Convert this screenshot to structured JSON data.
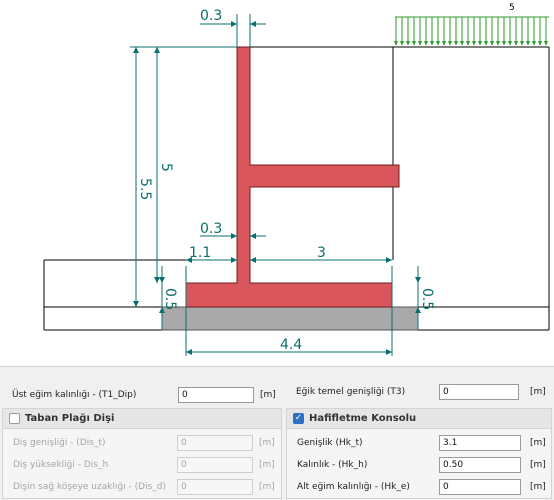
{
  "drawing": {
    "load_value": "5",
    "dim_top_thickness": "0.3",
    "dim_height_total": "5.5",
    "dim_height_wall": "5",
    "dim_bottom_thickness": "0.3",
    "dim_toe": "1.1",
    "dim_heel": "3",
    "dim_base_left": "0.5",
    "dim_base_right": "0.5",
    "dim_base_width": "4.4",
    "colors": {
      "wall": "#d9565c",
      "footing_lean": "#a9a9a9",
      "dimension": "#0b6f6f",
      "load": "#2e9d2e"
    }
  },
  "panel": {
    "top_left": {
      "label": "Üst eğim kalınlığı  - (T1_Dip)",
      "value": "0",
      "unit": "[m]"
    },
    "base_plate": {
      "title": "Taban Plağı Dişi",
      "checked": false,
      "rows": [
        {
          "label": "Diş genişliği - (Dis_t)",
          "value": "0",
          "unit": "[m]"
        },
        {
          "label": "Diş yüksekliği - Dis_h",
          "value": "0",
          "unit": "[m]"
        },
        {
          "label": "Dişin sağ köşeye uzaklığı - (Dis_d)",
          "value": "0",
          "unit": "[m]"
        }
      ]
    },
    "top_right": {
      "label": "Eğik temel genişliği (T3)",
      "value": "0",
      "unit": "[m]"
    },
    "relief": {
      "title": "Hafifletme Konsolu",
      "checked": true,
      "rows": [
        {
          "label": "Genişlik (Hk_t)",
          "value": "3.1",
          "unit": "[m]"
        },
        {
          "label": "Kalınlık - (Hk_h)",
          "value": "0.50",
          "unit": "[m]"
        },
        {
          "label": "Alt eğim kalınlığı - (Hk_e)",
          "value": "0",
          "unit": "[m]"
        }
      ]
    }
  }
}
